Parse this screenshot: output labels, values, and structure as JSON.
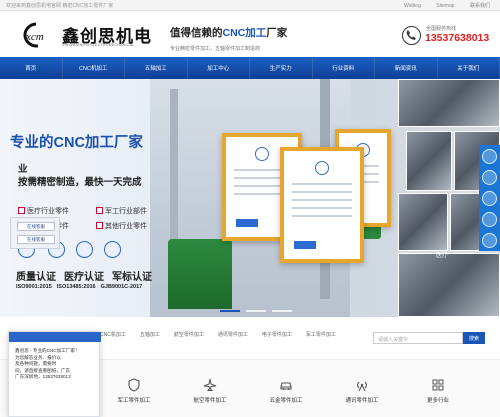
{
  "topbar": {
    "welcome": "欢迎来到鑫创思机电官网 精密CNC加工零件厂家",
    "links": [
      "Weblog",
      "Sitemap",
      "联系我们"
    ]
  },
  "header": {
    "logo_text": "鑫创思机电",
    "logo_en": "XINCHUANGSI ELECTROMECHANICAL",
    "slogan_prefix": "值得信赖的",
    "slogan_highlight": "CNC加工",
    "slogan_suffix": "厂家",
    "slogan_sub": "专业精密零件加工，五轴零件加工制造商",
    "hotline_label": "全国服务热线",
    "hotline_number": "13537638013"
  },
  "nav": {
    "items": [
      "首页",
      "CNC机加工",
      "五轴加工",
      "加工中心",
      "生产实力",
      "行业资料",
      "新闻资讯",
      "关于我们"
    ]
  },
  "banner": {
    "title": "专业的CNC加工厂家",
    "sub1": "业",
    "sub2": "按需精密制造，最快一天完成",
    "features": [
      "医疗行业零件",
      "军工行业部件",
      "航空航天零件",
      "其他行业零件"
    ],
    "cert_labels": [
      "质量认证",
      "医疗认证",
      "军标认证"
    ],
    "cert_codes": [
      "ISO9001:2015",
      "ISO13485:2016",
      "GJB9001C-2017"
    ],
    "cert_icon_names": [
      "iso-icon",
      "quality-icon",
      "iso-icon",
      "medical-icon"
    ],
    "photo_label": "医疗",
    "popup_items": [
      "在线客服",
      "在线客服"
    ]
  },
  "subnav": {
    "items": [
      "CNC机加工",
      "五轴加工",
      "航空零件加工",
      "通讯零件加工",
      "电子零件加工",
      "军工零件加工"
    ],
    "search_placeholder": "请输入关键字",
    "search_button": "搜索"
  },
  "categories": [
    {
      "label": "军工零件加工",
      "icon": "shield-icon"
    },
    {
      "label": "航空零件加工",
      "icon": "plane-icon"
    },
    {
      "label": "五金零件加工",
      "icon": "car-icon"
    },
    {
      "label": "通讯零件加工",
      "icon": "signal-icon"
    },
    {
      "label": "更多行业",
      "icon": "grid-icon"
    }
  ],
  "chat": {
    "lines": [
      "鑫创思 - 专业的CNC加工厂家！",
      "为您解答业务、报价以",
      "及各种问题，需要时",
      "间，请直接查看图纸，广东",
      "广东深圳地，13537638013"
    ]
  },
  "colors": {
    "brand_blue": "#1a56b5",
    "nav_blue": "#0d3f96",
    "hotline_red": "#e02020",
    "cert_gold": "#e7a62d"
  }
}
